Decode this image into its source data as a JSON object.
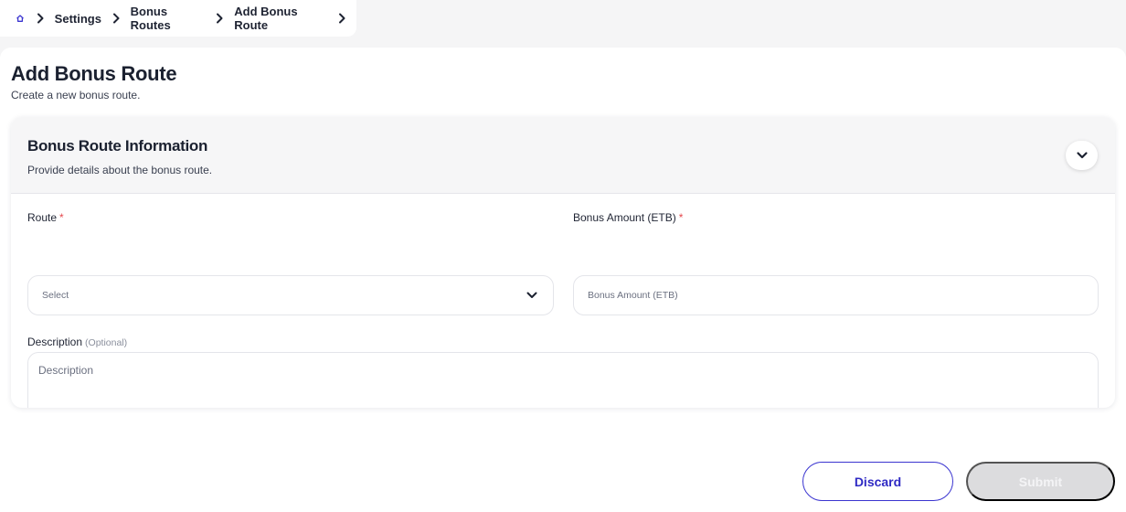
{
  "breadcrumb": {
    "items": [
      "Settings",
      "Bonus Routes",
      "Add Bonus Route"
    ]
  },
  "page": {
    "title": "Add Bonus Route",
    "subtitle": "Create a new bonus route."
  },
  "card": {
    "title": "Bonus Route Information",
    "subtitle": "Provide details about the bonus route."
  },
  "form": {
    "route": {
      "label": "Route",
      "required_mark": "*",
      "value": "Select"
    },
    "bonus_amount": {
      "label": "Bonus Amount (ETB)",
      "required_mark": "*",
      "placeholder": "Bonus Amount (ETB)"
    },
    "description": {
      "label": "Description",
      "optional_note": "(Optional)",
      "placeholder": "Description"
    }
  },
  "actions": {
    "discard_label": "Discard",
    "submit_label": "Submit"
  },
  "colors": {
    "accent": "#3b35d0",
    "required": "#e5484d",
    "disabled_button": "#dcdcde"
  },
  "icons": {
    "home": "home-icon",
    "breadcrumb_separator": "chevron-right-icon",
    "collapse": "chevron-down-icon",
    "select": "chevron-down-icon",
    "resize": "resize-handle-icon"
  }
}
